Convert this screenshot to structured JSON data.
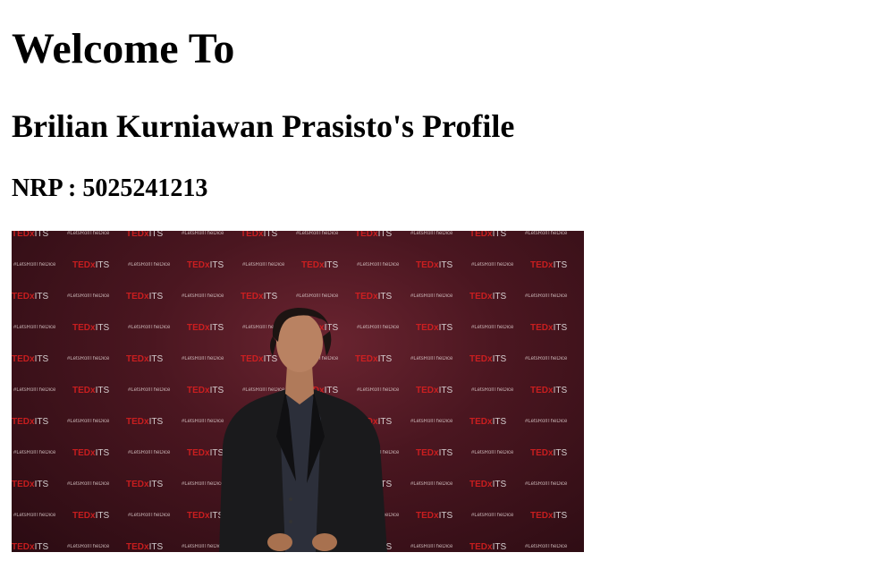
{
  "heading": {
    "welcome": "Welcome To",
    "profile": "Brilian Kurniawan Prasisto's Profile",
    "nrp": "NRP : 5025241213"
  },
  "photo": {
    "backdrop_tag": "#LetsRollTheDice",
    "backdrop_brand": "TEDx",
    "backdrop_brand_suffix": "ITS",
    "colors": {
      "backdrop": "#4a1620",
      "brand_red": "#e02020",
      "suit": "#1a1a1c",
      "shirt": "#2c2f3a"
    }
  }
}
